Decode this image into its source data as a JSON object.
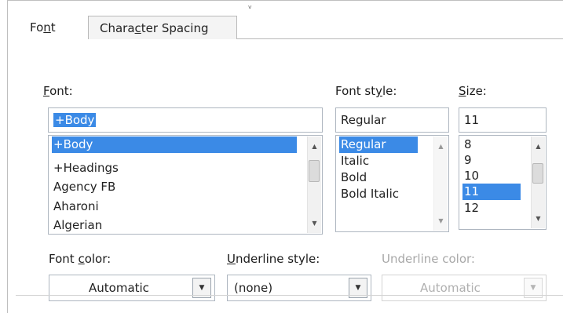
{
  "tabs": [
    {
      "label_pre": "Fo",
      "label_u": "n",
      "label_post": "t"
    },
    {
      "label_pre": "Chara",
      "label_u": "c",
      "label_post": "ter Spacing"
    }
  ],
  "font": {
    "label_u": "F",
    "label_rest": "ont:",
    "value": "+Body",
    "items": [
      "+Body",
      "+Headings",
      "Agency FB",
      "Aharoni",
      "Algerian"
    ],
    "selected_index": 0
  },
  "font_style": {
    "label_pre": "Font st",
    "label_u": "y",
    "label_post": "le:",
    "value": "Regular",
    "items": [
      "Regular",
      "Italic",
      "Bold",
      "Bold Italic"
    ],
    "selected_index": 0
  },
  "size": {
    "label_u": "S",
    "label_rest": "ize:",
    "value": "11",
    "items": [
      "8",
      "9",
      "10",
      "11",
      "12"
    ],
    "selected_index": 3
  },
  "font_color": {
    "label_pre": "Font ",
    "label_u": "c",
    "label_post": "olor:",
    "value": "Automatic"
  },
  "underline_style": {
    "label_u": "U",
    "label_rest": "nderline style:",
    "value": "(none)"
  },
  "underline_color": {
    "label": "Underline color:",
    "value": "Automatic",
    "disabled": true
  },
  "colors": {
    "selection": "#3b8ae6",
    "border": "#aeb6c0"
  }
}
